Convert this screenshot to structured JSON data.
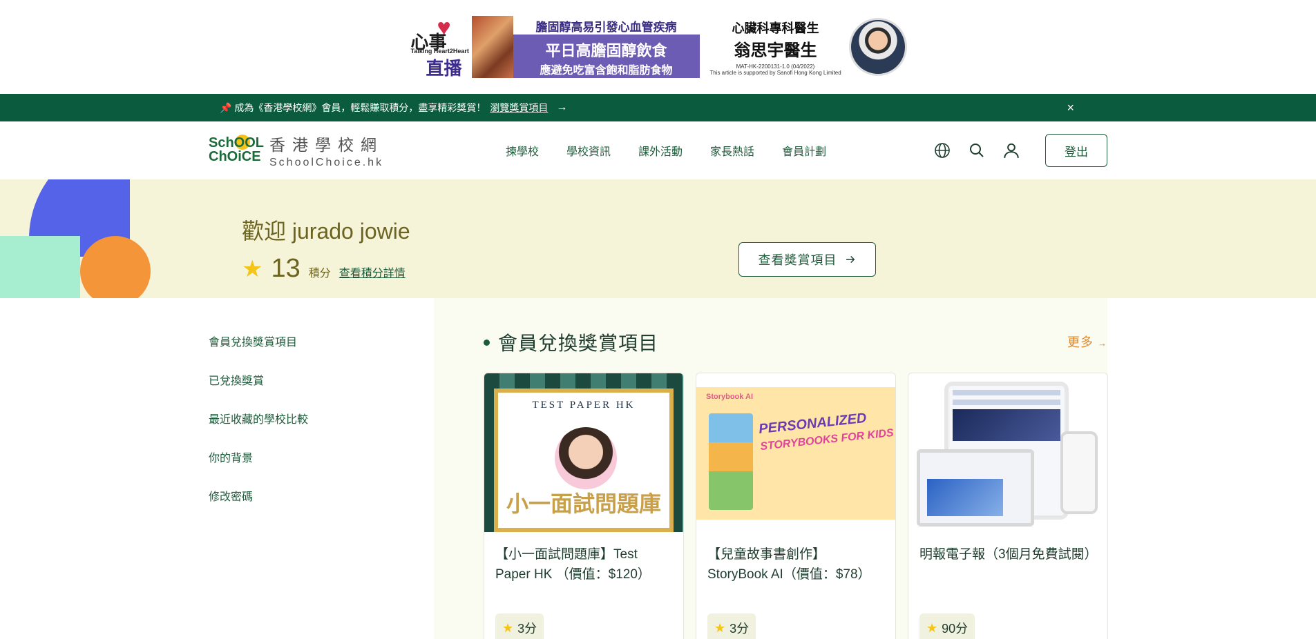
{
  "ad": {
    "brand_line1": "心事",
    "brand_line2": "Talking Heart2Heart",
    "brand_line3": "直播",
    "headline1": "膽固醇高易引發心血管疾病",
    "headline2": "平日高膽固醇飲食",
    "headline3": "應避免吃富含飽和脂肪食物",
    "doctor_title": "心臟科專科醫生",
    "doctor_name": "翁思宇醫生",
    "code": "MAT-HK-2200131-1.0 (04/2022)",
    "support": "This article is supported by Sanofi Hong Kong Limited"
  },
  "notice": {
    "text": "📌 成為《香港學校網》會員，輕鬆賺取積分，盡享精彩獎賞！",
    "link": "瀏覽獎賞項目",
    "close": "×"
  },
  "header": {
    "logo_mark_line1": "SchOOL",
    "logo_mark_line2": "ChOiCE",
    "logo_zh": "香港學校網",
    "logo_en": "SchoolChoice.hk",
    "nav": [
      "揀學校",
      "學校資訊",
      "課外活動",
      "家長熱話",
      "會員計劃"
    ],
    "logout": "登出"
  },
  "welcome": {
    "title": "歡迎 jurado jowie",
    "points": "13",
    "points_label": "積分",
    "points_link": "查看積分詳情",
    "rewards_button": "查看獎賞項目"
  },
  "sidebar": {
    "items": [
      "會員兌換獎賞項目",
      "已兌換獎賞",
      "最近收藏的學校比較",
      "你的背景",
      "修改密碼"
    ]
  },
  "section": {
    "title": "會員兌換獎賞項目",
    "more": "更多"
  },
  "cards": [
    {
      "title": "【小一面試問題庫】Test Paper HK （價值：$120）",
      "points": "3分",
      "image_caption_en": "TEST PAPER HK",
      "image_caption_zh": "小一面試問題庫"
    },
    {
      "title": "【兒童故事書創作】StoryBook AI（價值：$78）",
      "points": "3分",
      "image_brand": "Storybook AI",
      "image_headline1": "PERSONALIZED",
      "image_headline2": "STORYBOOKS FOR KIDS"
    },
    {
      "title": "明報電子報（3個月免費試閱）",
      "points": "90分"
    }
  ],
  "colors": {
    "primary_green": "#0b5b3f",
    "accent_orange": "#e08a2e",
    "welcome_bg": "#f5f4d9",
    "star": "#f4c418"
  }
}
